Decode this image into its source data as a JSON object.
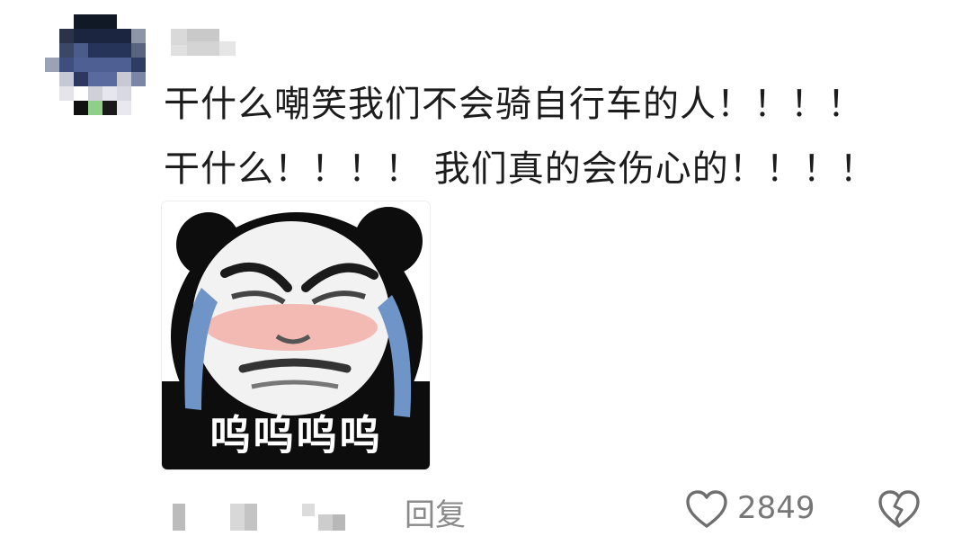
{
  "comment": {
    "lines": [
      "干什么嘲笑我们不会骑自行车的人！！！！",
      "干什么！！！！ 我们真的会伤心的！！！！"
    ],
    "sticker": {
      "caption": "呜呜呜呜",
      "icon": "crying-panda-sticker"
    },
    "actions": {
      "reply_label": "回复",
      "like_count": "2849",
      "like_icon": "heart-outline-icon",
      "dislike_icon": "broken-heart-icon"
    }
  }
}
